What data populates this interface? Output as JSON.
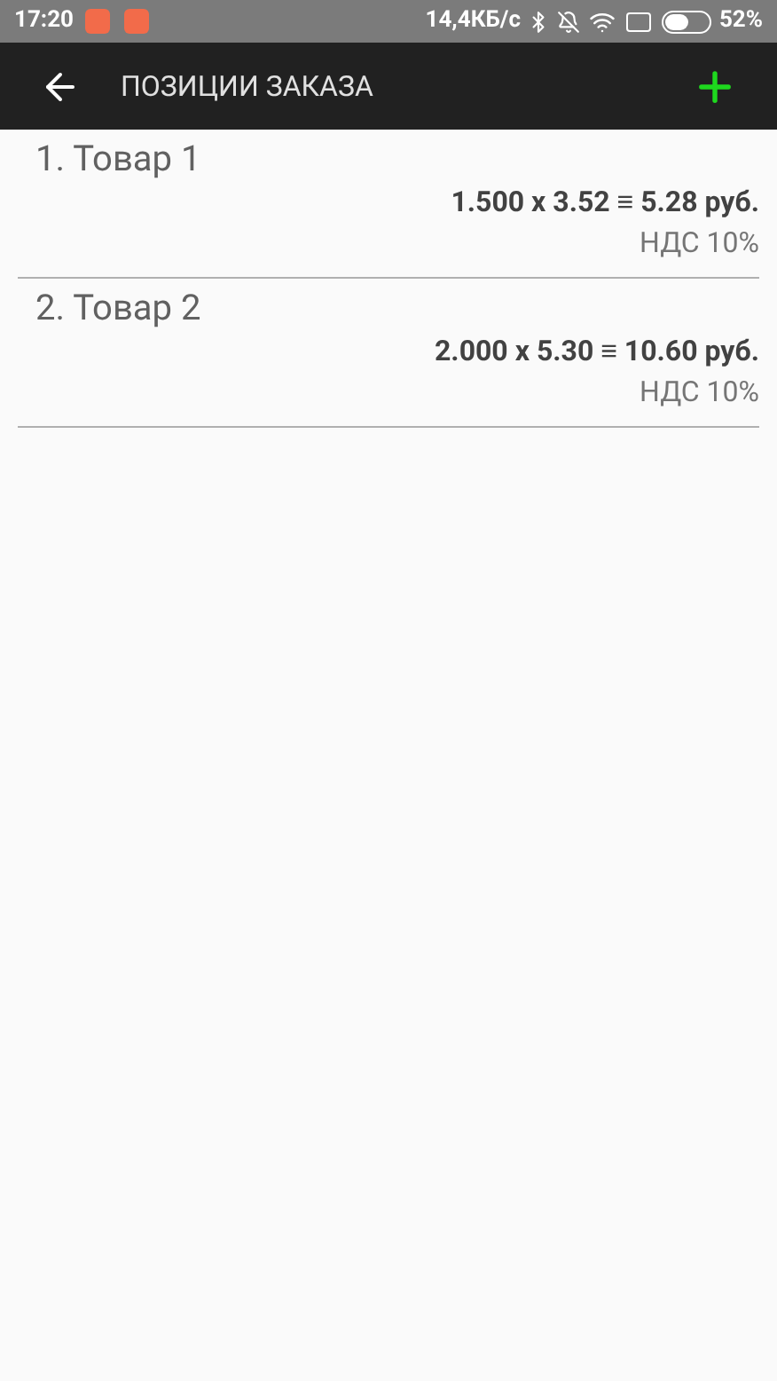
{
  "status_bar": {
    "time": "17:20",
    "speed": "14,4КБ/с",
    "battery": "52%"
  },
  "toolbar": {
    "title": "ПОЗИЦИИ ЗАКАЗА"
  },
  "items": [
    {
      "title": "1. Товар 1",
      "amount": "1.500 x 3.52 ≡ 5.28 руб.",
      "vat": "НДС 10%"
    },
    {
      "title": "2. Товар 2",
      "amount": "2.000 x 5.30 ≡ 10.60 руб.",
      "vat": "НДС 10%"
    }
  ]
}
